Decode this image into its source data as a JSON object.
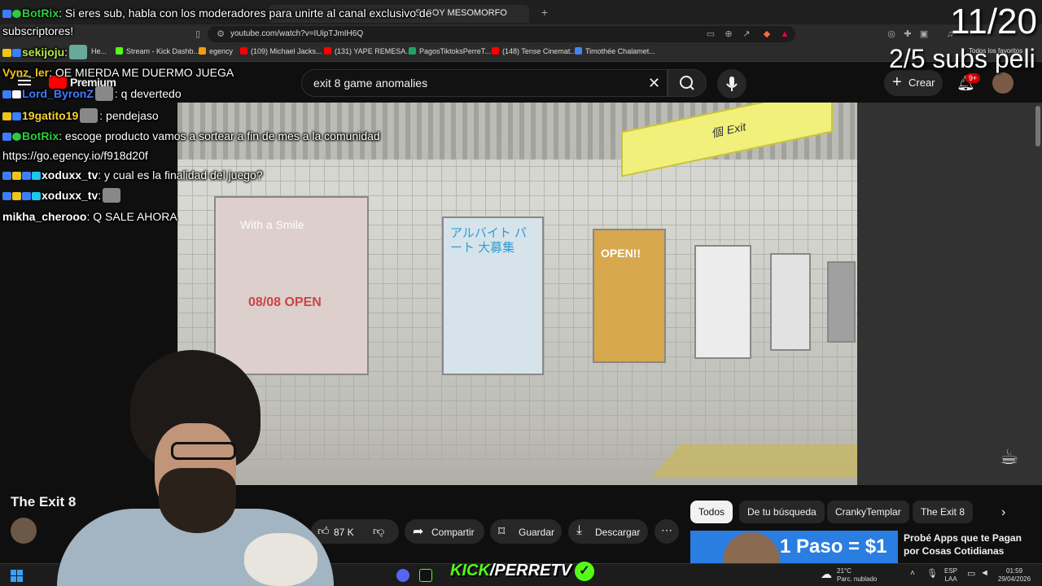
{
  "browser": {
    "tabs": [
      "",
      "",
      "",
      "SI SOY MESOMORFO"
    ],
    "url": "youtube.com/watch?v=IUipTJmIH6Q",
    "bookmarks": [
      {
        "label": "He...",
        "color": "#9c6"
      },
      {
        "label": "Stream - Kick Dashb...",
        "color": "#53fc18"
      },
      {
        "label": "egency",
        "color": "#f39c12"
      },
      {
        "label": "(109) Michael Jacks...",
        "color": "#ff0000"
      },
      {
        "label": "(131) YAPE REMESA...",
        "color": "#ff0000"
      },
      {
        "label": "PagosTiktoksPerreT...",
        "color": "#1fa463"
      },
      {
        "label": "(148) Tense Cinemat...",
        "color": "#ff0000"
      },
      {
        "label": "Timothée Chalamet...",
        "color": "#4285f4"
      }
    ],
    "all_bookmarks": "Todos los favoritos"
  },
  "youtube": {
    "logo": "Premium",
    "search_value": "exit 8 game anomalies",
    "create_label": "Crear",
    "notif_badge": "9+",
    "video_title": "The Exit 8",
    "actions": {
      "likes": "87 K",
      "share": "Compartir",
      "save": "Guardar",
      "download": "Descargar"
    },
    "chips": [
      "Todos",
      "De tu búsqueda",
      "CrankyTemplar",
      "The Exit 8"
    ],
    "recommended": {
      "thumb_text": "1 Paso = $1",
      "title": "Probé Apps que te Pagan por Cosas Cotidianas"
    },
    "player": {
      "sign_text": "個 Exit",
      "posters": [
        "With a Smile",
        "08/08 OPEN",
        "アルバイト パート 大募集",
        "OPEN!!"
      ]
    }
  },
  "overlay": {
    "counter": "11/20",
    "subs_goal": "2/5 subs peli",
    "kick_brand": {
      "k": "KICK",
      "name": "/PERRETV"
    },
    "chat": [
      {
        "user": "BotRix",
        "class": "u-botrix",
        "msg": ": Si eres sub, habla con los moderadores para unirte al canal exclusivo de"
      },
      {
        "user": "",
        "class": "",
        "msg": "subscriptores!"
      },
      {
        "user": "sekijoju",
        "class": "u-seki",
        "msg": ":"
      },
      {
        "user": "Vynz_ler",
        "class": "u-vynz",
        "msg": ": OE MIERDA ME DUERMO JUEGA"
      },
      {
        "user": "Lord_ByronZ",
        "class": "u-lord",
        "msg": ": q devertedo"
      },
      {
        "user": "19gatito19",
        "class": "u-gatito",
        "msg": ": pendejaso"
      },
      {
        "user": "BotRix",
        "class": "u-botrix",
        "msg": ": escoge producto vamos a sortear a fin de mes a la comunidad"
      },
      {
        "user": "",
        "class": "",
        "msg": "https://go.egency.io/f918d20f"
      },
      {
        "user": "xoduxx_tv",
        "class": "u-xod",
        "msg": ": y cual es la finalidad del juego?"
      },
      {
        "user": "xoduxx_tv",
        "class": "u-xod",
        "msg": ":"
      },
      {
        "user": "mikha_cherooo",
        "class": "u-mikha",
        "msg": ": Q SALE AHORA"
      }
    ]
  },
  "taskbar": {
    "weather_temp": "21°C",
    "weather_desc": "Parc. nublado",
    "lang": "ESP",
    "lang2": "LAA",
    "time": "01:59",
    "date": "29/04/2026"
  },
  "colors": {
    "yt_bg": "#0f0f0f",
    "kick_green": "#53fc18",
    "botrix_green": "#2ecc40",
    "notif_red": "#cc0000"
  }
}
